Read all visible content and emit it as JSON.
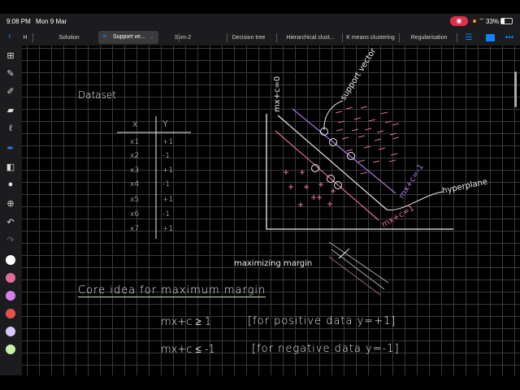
{
  "status": {
    "time": "9:08 PM",
    "date": "Mon 9 Mar",
    "battery": "33%"
  },
  "tabs": [
    {
      "label": "H"
    },
    {
      "label": "Solution"
    },
    {
      "label": "Support ve...",
      "active": true
    },
    {
      "label": "Svm-2"
    },
    {
      "label": "Decision tree"
    },
    {
      "label": "Hierarchical clust..."
    },
    {
      "label": "K means clustering"
    },
    {
      "label": "Regularisation"
    }
  ],
  "icons": {
    "back": "chevron-left-icon",
    "list": "list-icon",
    "page": "square-icon",
    "more": "more-icon",
    "close": "close-icon",
    "chevron": "chevron-down-icon"
  },
  "tools": [
    "grid-icon",
    "pen-icon",
    "highlighter-icon",
    "eraser-icon",
    "lasso-icon",
    "marker-icon",
    "shapes-icon",
    "sticker-icon",
    "add-icon",
    "undo-icon",
    "redo-icon"
  ],
  "colors": {
    "accent": "#0a84ff",
    "record": "#e0314b",
    "palette": [
      "#ffffff",
      "#e06b9a",
      "#d77ff0",
      "#e5534b",
      "#d8c8ff",
      "#c8f0a8"
    ],
    "pink": "#e0709a",
    "purple": "#a978e0",
    "green": "#cfe8b8"
  },
  "notes": {
    "dataset_title": "Dataset",
    "table": {
      "headers": [
        "x",
        "Y"
      ],
      "rows": [
        [
          "x1",
          "+1"
        ],
        [
          "x2",
          "-1"
        ],
        [
          "x3",
          "+1"
        ],
        [
          "x4",
          "-1"
        ],
        [
          "x5",
          "+1"
        ],
        [
          "x6",
          "-1"
        ],
        [
          "x7",
          "+1"
        ]
      ]
    },
    "labels": {
      "hyperplane_eq": "mx+c=0",
      "support_vector": "support vector",
      "neg_margin": "mx+c=-1",
      "pos_margin": "mx+c=1",
      "hyperplane": "hyperplane",
      "maximizing": "maximizing margin"
    },
    "heading": "Core idea for maximum margin",
    "eq1": "mx+c ≥ 1",
    "cond1": "[for positive data y=+1]",
    "eq2": "mx+c ≤ -1",
    "cond2": "[for negative data y=-1]"
  }
}
